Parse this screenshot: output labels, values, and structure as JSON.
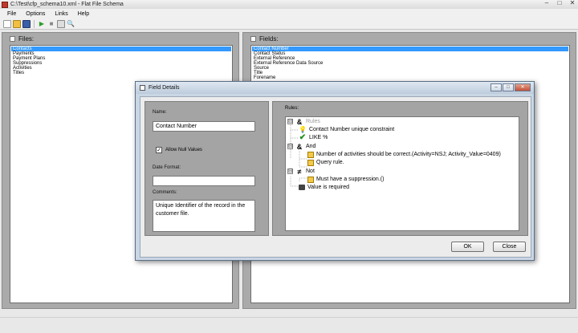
{
  "window": {
    "title": "C:\\Test\\cfp_schema10.xml - Flat File Schema",
    "controls": {
      "minimize": "–",
      "maximize": "□",
      "close": "✕"
    }
  },
  "menu": {
    "items": [
      "File",
      "Options",
      "Links",
      "Help"
    ]
  },
  "toolbar": {
    "icons": [
      "new-icon",
      "open-icon",
      "save-icon",
      "run-icon",
      "stop-icon",
      "copy-icon",
      "zoom-icon"
    ]
  },
  "files_panel": {
    "label": "Files:",
    "items": [
      "Contacts",
      "Payments",
      "Payment Plans",
      "Suppressions",
      "Activities",
      "Titles"
    ],
    "selected_index": 0
  },
  "fields_panel": {
    "label": "Fields:",
    "items": [
      "Contact Number",
      "Contact Status",
      "External Reference",
      "External Reference Data Source",
      "Source",
      "Title",
      "Forename"
    ],
    "selected_index": 0
  },
  "dialog": {
    "title": "Field Details",
    "name_label": "Name:",
    "name_value": "Contact Number",
    "allow_null_label": "Allow Null Values",
    "allow_null_checked": true,
    "date_format_label": "Date Format:",
    "date_format_value": "",
    "comments_label": "Comments:",
    "comments_value": "Unique Identifier of the record in the customer file.",
    "rules_label": "Rules:",
    "rules_tree": [
      {
        "text": "Rules",
        "icon": "and-icon",
        "glyph": "&",
        "expander": "⊟",
        "muted": true
      },
      {
        "text": "Contact Number unique constraint",
        "icon": "bulb-icon",
        "glyph": "💡"
      },
      {
        "text": "LIKE %",
        "icon": "check-icon",
        "glyph": "✔"
      },
      {
        "text": "And",
        "icon": "and-icon",
        "glyph": "&",
        "expander": "⊟"
      },
      {
        "text": "Number of activities should be correct.(Activity=NSJ; Activity_Value=0409)",
        "icon": "query-icon"
      },
      {
        "text": "Query rule.",
        "icon": "query-icon"
      },
      {
        "text": "Not",
        "icon": "not-icon",
        "glyph": "≠",
        "expander": "⊟"
      },
      {
        "text": "Must have a suppression.()",
        "icon": "query-icon"
      },
      {
        "text": "Value is required",
        "icon": "lock-icon"
      }
    ],
    "ok_label": "OK",
    "close_label": "Close"
  }
}
